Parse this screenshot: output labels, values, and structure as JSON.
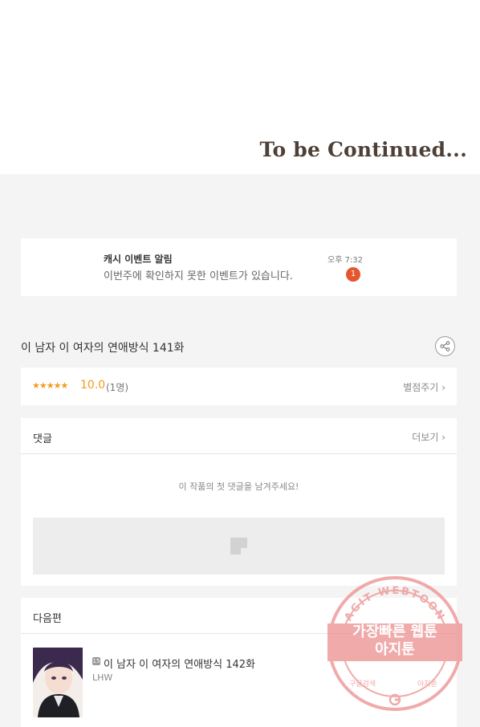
{
  "viewer": {
    "end_banner": "To be Continued..."
  },
  "notification": {
    "title": "캐시 이벤트 알림",
    "message": "이번주에 확인하지 못한 이벤트가 있습니다.",
    "time": "오후 7:32",
    "badge_count": "1"
  },
  "episode": {
    "title": "이 남자 이 여자의 연애방식 141화",
    "share_icon": "share-icon"
  },
  "rating": {
    "stars": "★★★★★",
    "score": "10.0",
    "count": "(1명)",
    "rate_link": "별점주기",
    "chevron": "›",
    "star_color": "#f39a1d"
  },
  "comments": {
    "header": "댓글",
    "more_link": "더보기",
    "chevron": "›",
    "empty_message": "이 작품의 첫 댓글을 남겨주세요!",
    "write_icon": "comment-write-icon"
  },
  "next_episode": {
    "header": "다음편",
    "age_badge": "15",
    "title": "이 남자 이 여자의 연애방식 142화",
    "author": "LHW"
  },
  "watermark": {
    "arc_text": "AGIT WEBTOON",
    "line1": "가장빠른 웹툰",
    "line2": "아지툰",
    "bottom_left": "구글검색",
    "bottom_right": "아지툰"
  }
}
